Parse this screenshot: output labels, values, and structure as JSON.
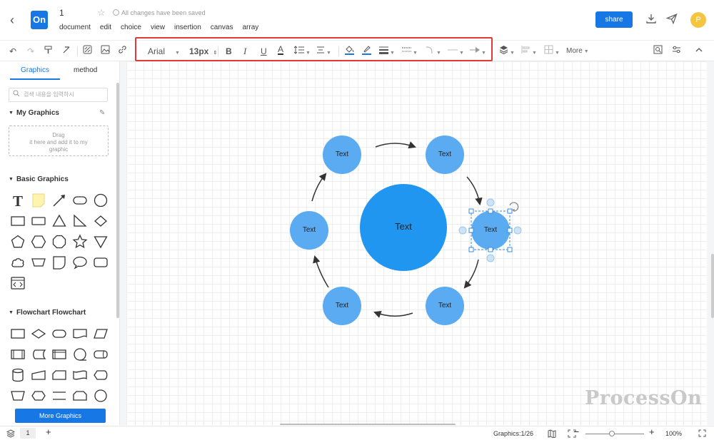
{
  "app": {
    "logo": "On",
    "doc_title": "1",
    "saved_status": "All changes have been saved"
  },
  "menu": [
    "document",
    "edit",
    "choice",
    "view",
    "insertion",
    "canvas",
    "array"
  ],
  "header": {
    "share_label": "share",
    "avatar_initial": "P"
  },
  "toolbar": {
    "font_family": "Arial",
    "font_size": "13px",
    "bold": "B",
    "italic": "I",
    "underline": "U",
    "font_color": "A",
    "more_label": "More"
  },
  "left": {
    "tabs": [
      "Graphics",
      "method"
    ],
    "search_placeholder": "검색 내용을 입력하시",
    "my_graphics": "My Graphics",
    "dropzone_line1": "Drag",
    "dropzone_line2": "it here and add it to my",
    "dropzone_line3": "graphic",
    "basic_graphics": "Basic Graphics",
    "flowchart": "Flowchart Flowchart",
    "more_graphics": "More Graphics"
  },
  "diagram": {
    "center_label": "Text",
    "nodes": [
      "Text",
      "Text",
      "Text",
      "Text",
      "Text",
      "Text"
    ],
    "center_color": "#2196f0",
    "node_color": "#5aabf2"
  },
  "watermark": "ProcessOn",
  "footer": {
    "page": "1",
    "graphics_count": "Graphics:1/26",
    "zoom": "100%"
  }
}
